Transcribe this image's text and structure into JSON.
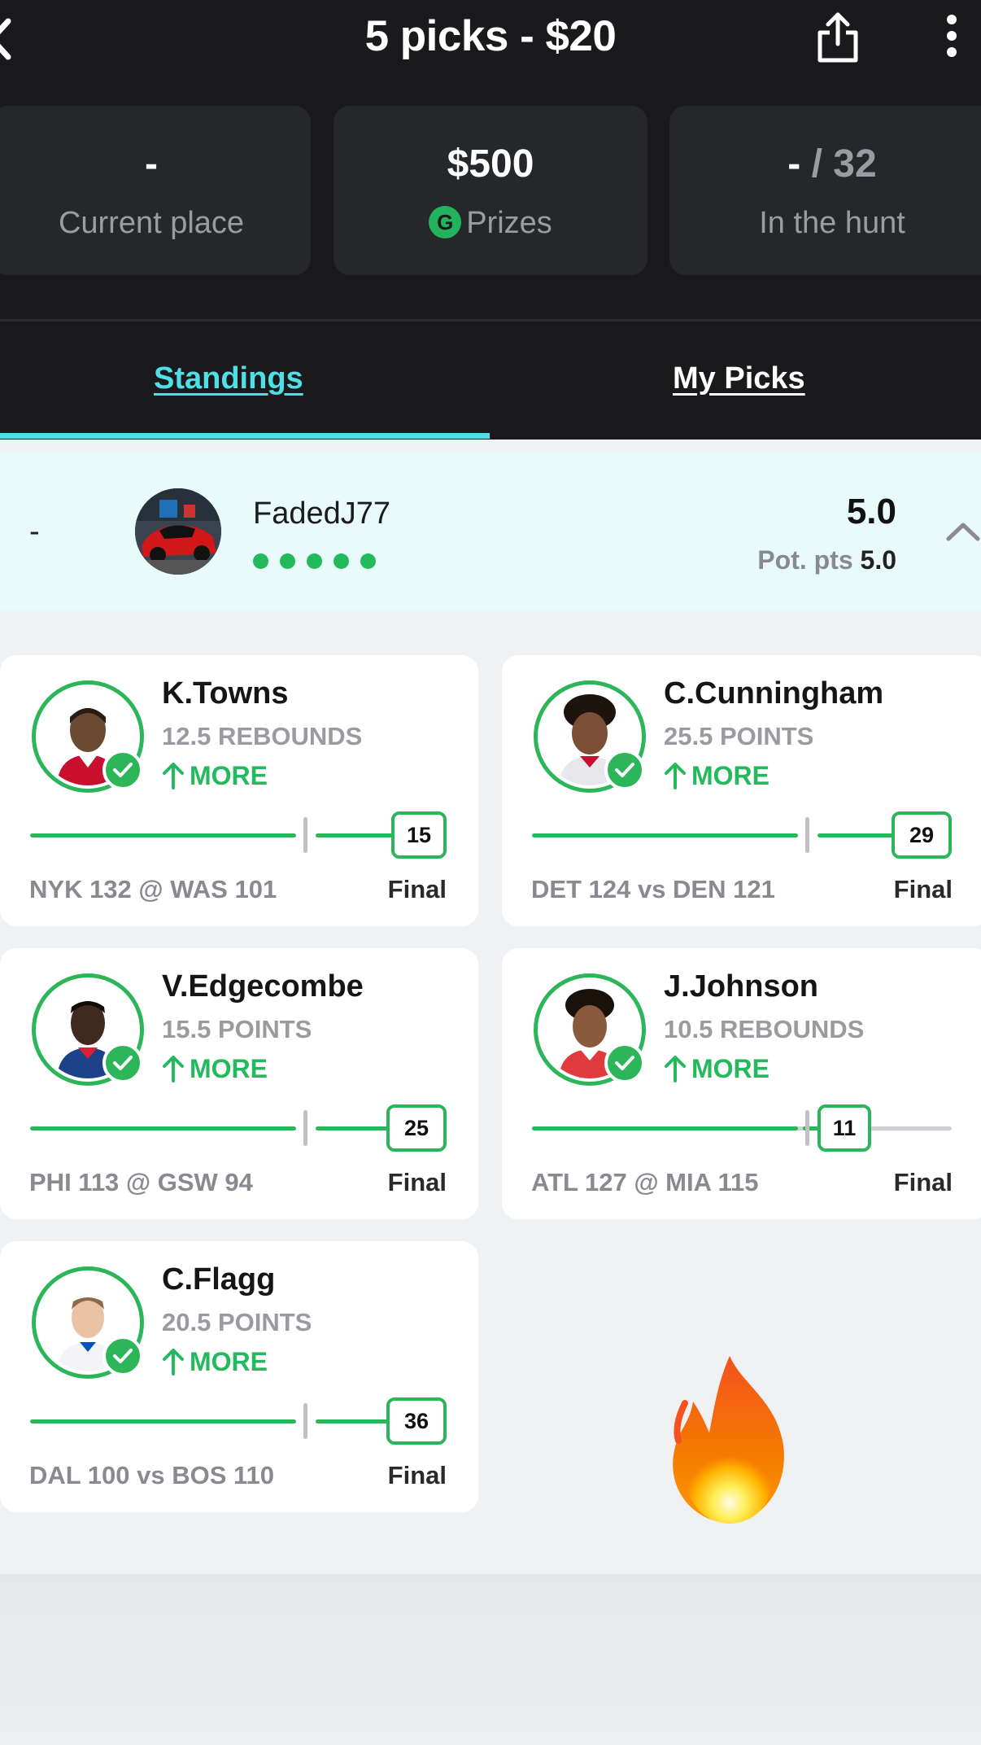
{
  "header": {
    "title": "5 picks - $20",
    "back_icon": "chevron-left-icon",
    "share_icon": "share-icon",
    "more_icon": "more-vertical-icon"
  },
  "stats": {
    "current_place": {
      "value": "-",
      "label": "Current place"
    },
    "prizes": {
      "value": "$500",
      "badge": "G",
      "label": "Prizes"
    },
    "hunt": {
      "value_main": "-",
      "value_dim": " / 32",
      "label": "In the hunt"
    }
  },
  "tabs": {
    "standings": "Standings",
    "my_picks": "My Picks",
    "active": "Standings"
  },
  "user": {
    "rank": "-",
    "name": "FadedJ77",
    "score": "5.0",
    "pot_label": "Pot. pts ",
    "pot_value": "5.0",
    "dots_count": 5
  },
  "picks": [
    {
      "name": "K.Towns",
      "line": "12.5 REBOUNDS",
      "direction": "MORE",
      "actual": "15",
      "line_value": 12.5,
      "game": "NYK 132 @ WAS 101",
      "status": "Final"
    },
    {
      "name": "C.Cunningham",
      "line": "25.5 POINTS",
      "direction": "MORE",
      "actual": "29",
      "line_value": 25.5,
      "game": "DET 124 vs DEN 121",
      "status": "Final"
    },
    {
      "name": "V.Edgecombe",
      "line": "15.5 POINTS",
      "direction": "MORE",
      "actual": "25",
      "line_value": 15.5,
      "game": "PHI 113 @ GSW 94",
      "status": "Final"
    },
    {
      "name": "J.Johnson",
      "line": "10.5 REBOUNDS",
      "direction": "MORE",
      "actual": "11",
      "line_value": 10.5,
      "game": "ATL 127 @ MIA 115",
      "status": "Final"
    },
    {
      "name": "C.Flagg",
      "line": "20.5 POINTS",
      "direction": "MORE",
      "actual": "36",
      "line_value": 20.5,
      "game": "DAL 100 vs BOS 110",
      "status": "Final"
    }
  ],
  "colors": {
    "accent": "#4ee0e6",
    "success": "#24b95d",
    "dark_bg": "#1a1a1c",
    "card_bg": "#26272b"
  },
  "decorations": {
    "fire": "fire-emoji-icon"
  }
}
